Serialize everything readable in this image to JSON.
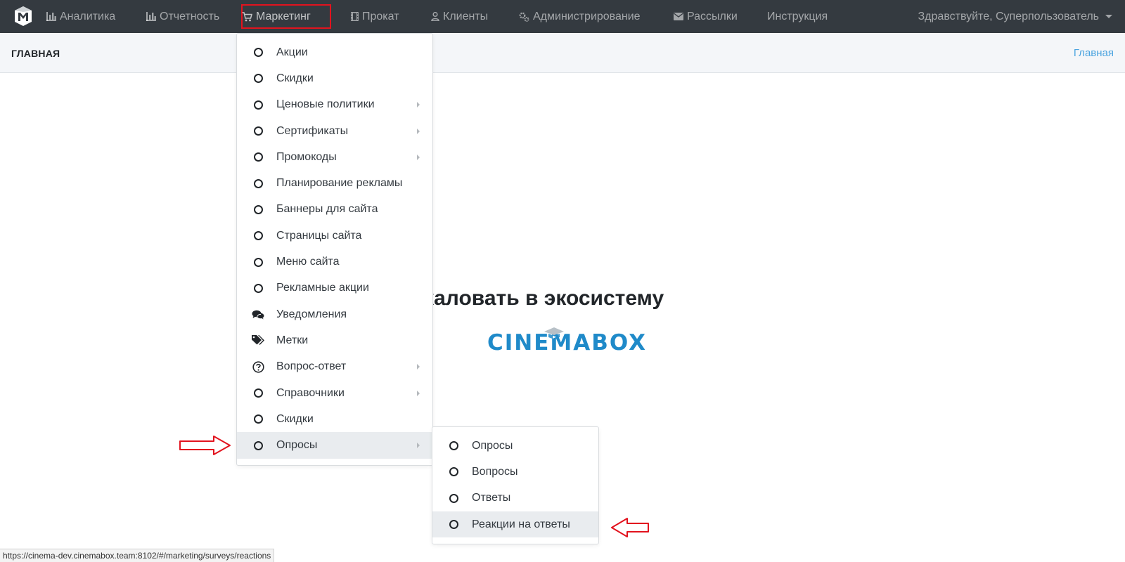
{
  "navbar": {
    "items": [
      {
        "label": "Аналитика",
        "icon": "bar-chart-icon"
      },
      {
        "label": "Отчетность",
        "icon": "bar-chart-icon"
      },
      {
        "label": "Маркетинг",
        "icon": "cart-icon"
      },
      {
        "label": "Прокат",
        "icon": "film-icon"
      },
      {
        "label": "Клиенты",
        "icon": "user-icon"
      },
      {
        "label": "Администрирование",
        "icon": "gears-icon"
      },
      {
        "label": "Рассылки",
        "icon": "envelope-icon"
      },
      {
        "label": "Инструкция",
        "icon": ""
      }
    ],
    "user_greeting": "Здравствуйте, Суперпользователь",
    "highlight_color": "#e2131e"
  },
  "subheader": {
    "title": "ГЛАВНАЯ",
    "breadcrumb": "Главная"
  },
  "main": {
    "welcome_text": "Добро пожаловать в экосистему",
    "brand": "CINEMABOX"
  },
  "marketing_menu": {
    "items": [
      {
        "label": "Акции",
        "icon": "circle-icon",
        "has_submenu": false
      },
      {
        "label": "Скидки",
        "icon": "circle-icon",
        "has_submenu": false
      },
      {
        "label": "Ценовые политики",
        "icon": "circle-icon",
        "has_submenu": true
      },
      {
        "label": "Сертификаты",
        "icon": "circle-icon",
        "has_submenu": true
      },
      {
        "label": "Промокоды",
        "icon": "circle-icon",
        "has_submenu": true
      },
      {
        "label": "Планирование рекламы",
        "icon": "circle-icon",
        "has_submenu": false
      },
      {
        "label": "Баннеры для сайта",
        "icon": "circle-icon",
        "has_submenu": false
      },
      {
        "label": "Страницы сайта",
        "icon": "circle-icon",
        "has_submenu": false
      },
      {
        "label": "Меню сайта",
        "icon": "circle-icon",
        "has_submenu": false
      },
      {
        "label": "Рекламные акции",
        "icon": "circle-icon",
        "has_submenu": false
      },
      {
        "label": "Уведомления",
        "icon": "comments-icon",
        "has_submenu": false
      },
      {
        "label": "Метки",
        "icon": "tags-icon",
        "has_submenu": false
      },
      {
        "label": "Вопрос-ответ",
        "icon": "question-circle-icon",
        "has_submenu": true
      },
      {
        "label": "Справочники",
        "icon": "circle-icon",
        "has_submenu": true
      },
      {
        "label": "Скидки",
        "icon": "circle-icon",
        "has_submenu": false
      },
      {
        "label": "Опросы",
        "icon": "circle-icon",
        "has_submenu": true,
        "active": true
      }
    ]
  },
  "surveys_submenu": {
    "items": [
      {
        "label": "Опросы",
        "icon": "circle-icon"
      },
      {
        "label": "Вопросы",
        "icon": "circle-icon"
      },
      {
        "label": "Ответы",
        "icon": "circle-icon"
      },
      {
        "label": "Реакции на ответы",
        "icon": "circle-icon",
        "active": true
      }
    ]
  },
  "status_bar": {
    "url": "https://cinema-dev.cinemabox.team:8102/#/marketing/surveys/reactions"
  },
  "colors": {
    "navbar_bg": "#343a40",
    "brand_blue": "#1f8ac9",
    "link_blue": "#4aa3df",
    "annotation_red": "#e2131e",
    "active_item_bg": "#e9ecef"
  }
}
